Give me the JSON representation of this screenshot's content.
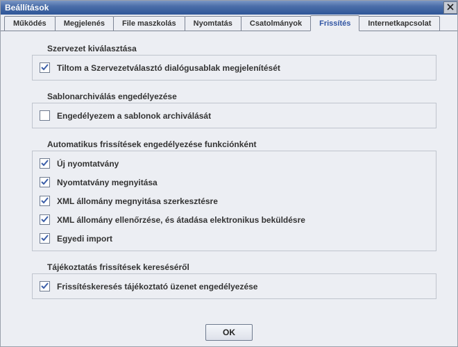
{
  "window": {
    "title": "Beállítások"
  },
  "tabs": [
    {
      "label": "Működés",
      "active": false
    },
    {
      "label": "Megjelenés",
      "active": false
    },
    {
      "label": "File maszkolás",
      "active": false
    },
    {
      "label": "Nyomtatás",
      "active": false
    },
    {
      "label": "Csatolmányok",
      "active": false
    },
    {
      "label": "Frissítés",
      "active": true
    },
    {
      "label": "Internetkapcsolat",
      "active": false
    }
  ],
  "groups": {
    "org": {
      "title": "Szervezet kiválasztása",
      "items": [
        {
          "label": "Tiltom a Szervezetválasztó dialógusablak megjelenítését",
          "checked": true
        }
      ]
    },
    "template": {
      "title": "Sablonarchiválás engedélyezése",
      "items": [
        {
          "label": "Engedélyezem a sablonok archiválását",
          "checked": false
        }
      ]
    },
    "auto": {
      "title": "Automatikus frissítések engedélyezése funkciónként",
      "items": [
        {
          "label": "Új nyomtatvány",
          "checked": true
        },
        {
          "label": "Nyomtatvány megnyitása",
          "checked": true
        },
        {
          "label": "XML állomány megnyitása szerkesztésre",
          "checked": true
        },
        {
          "label": "XML állomány ellenőrzése, és átadása elektronikus beküldésre",
          "checked": true
        },
        {
          "label": "Egyedi import",
          "checked": true
        }
      ]
    },
    "notify": {
      "title": "Tájékoztatás frissítések kereséséről",
      "items": [
        {
          "label": "Frissítéskeresés tájékoztató üzenet engedélyezése",
          "checked": true
        }
      ]
    }
  },
  "buttons": {
    "ok": "OK"
  }
}
